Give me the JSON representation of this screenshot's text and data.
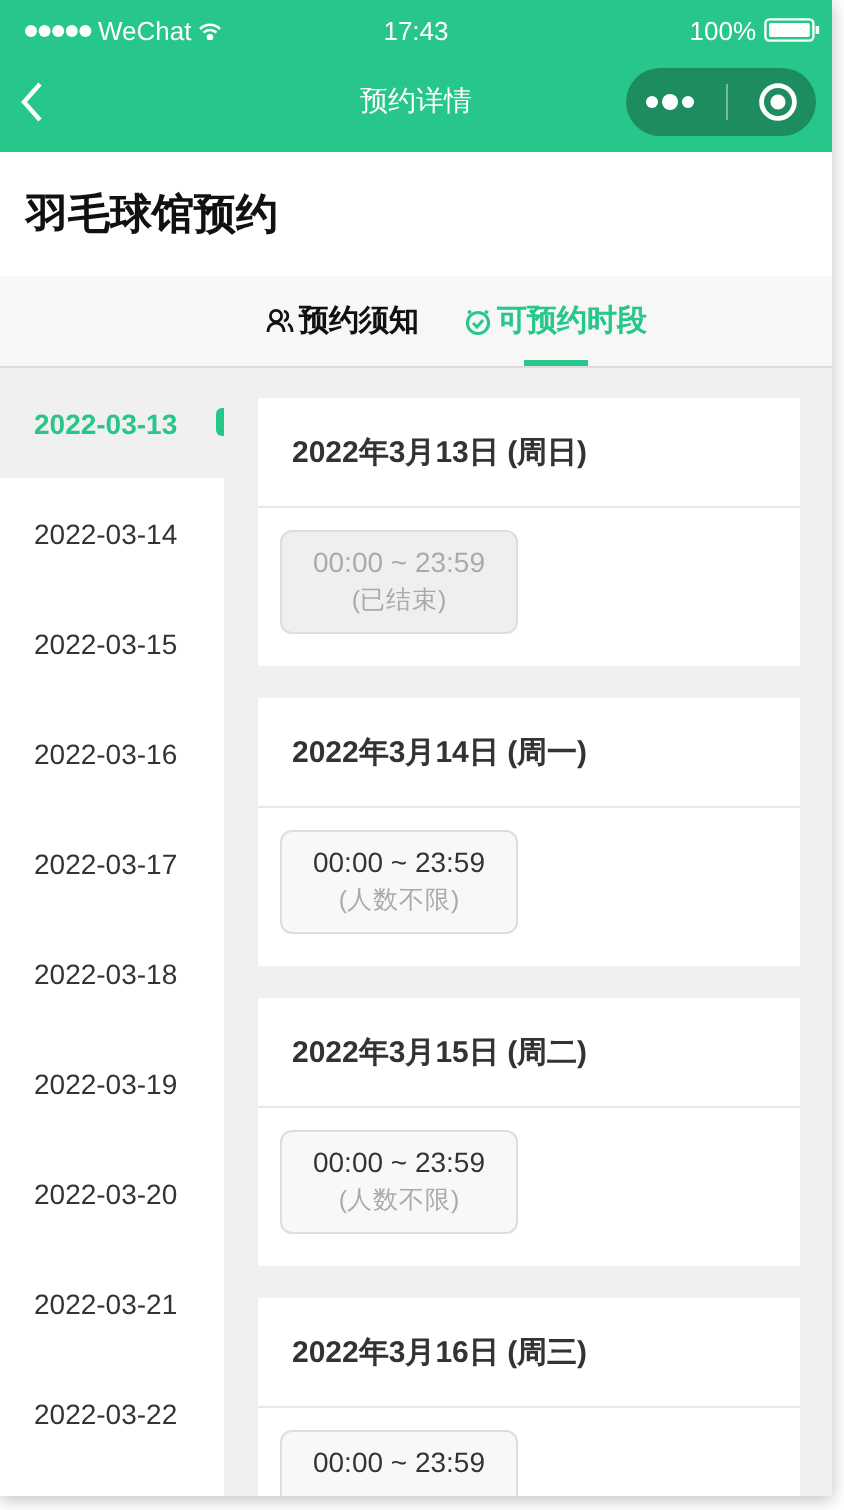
{
  "status_bar": {
    "carrier": "WeChat",
    "time": "17:43",
    "battery": "100%"
  },
  "nav": {
    "title": "预约详情"
  },
  "page_title": "羽毛球馆预约",
  "tabs": [
    {
      "label": "预约须知",
      "selected": false
    },
    {
      "label": "可预约时段",
      "selected": true
    }
  ],
  "dates": [
    {
      "label": "2022-03-13",
      "selected": true
    },
    {
      "label": "2022-03-14",
      "selected": false
    },
    {
      "label": "2022-03-15",
      "selected": false
    },
    {
      "label": "2022-03-16",
      "selected": false
    },
    {
      "label": "2022-03-17",
      "selected": false
    },
    {
      "label": "2022-03-18",
      "selected": false
    },
    {
      "label": "2022-03-19",
      "selected": false
    },
    {
      "label": "2022-03-20",
      "selected": false
    },
    {
      "label": "2022-03-21",
      "selected": false
    },
    {
      "label": "2022-03-22",
      "selected": false
    }
  ],
  "days": [
    {
      "title": "2022年3月13日 (周日)",
      "slots": [
        {
          "time": "00:00 ~ 23:59",
          "note": "(已结束)",
          "ended": true
        }
      ]
    },
    {
      "title": "2022年3月14日 (周一)",
      "slots": [
        {
          "time": "00:00 ~ 23:59",
          "note": "(人数不限)",
          "ended": false
        }
      ]
    },
    {
      "title": "2022年3月15日 (周二)",
      "slots": [
        {
          "time": "00:00 ~ 23:59",
          "note": "(人数不限)",
          "ended": false
        }
      ]
    },
    {
      "title": "2022年3月16日 (周三)",
      "slots": [
        {
          "time": "00:00 ~ 23:59",
          "ended": false
        }
      ]
    }
  ]
}
